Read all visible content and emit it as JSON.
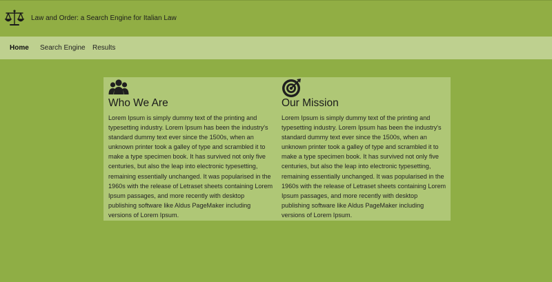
{
  "header": {
    "app_title": "Law and Order: a Search Engine for Italian Law",
    "logo_icon": "scales-of-justice-icon"
  },
  "nav": {
    "items": [
      {
        "label": "Home",
        "active": true
      },
      {
        "label": "Search Engine",
        "active": false
      },
      {
        "label": "Results",
        "active": false
      }
    ]
  },
  "sections": [
    {
      "icon": "users-icon",
      "title": "Who We Are",
      "body": "Lorem Ipsum is simply dummy text of the printing and typesetting industry. Lorem Ipsum has been the industry's standard dummy text ever since the 1500s, when an unknown printer took a galley of type and scrambled it to make a type specimen book. It has survived not only five centuries, but also the leap into electronic typesetting, remaining essentially unchanged. It was popularised in the 1960s with the release of Letraset sheets containing Lorem Ipsum passages, and more recently with desktop publishing software like Aldus PageMaker including versions of Lorem Ipsum."
    },
    {
      "icon": "target-icon",
      "title": "Our Mission",
      "body": "Lorem Ipsum is simply dummy text of the printing and typesetting industry. Lorem Ipsum has been the industry's standard dummy text ever since the 1500s, when an unknown printer took a galley of type and scrambled it to make a type specimen book. It has survived not only five centuries, but also the leap into electronic typesetting, remaining essentially unchanged. It was popularised in the 1960s with the release of Letraset sheets containing Lorem Ipsum passages, and more recently with desktop publishing software like Aldus PageMaker including versions of Lorem Ipsum."
    }
  ],
  "colors": {
    "page_background": "#8fae45",
    "nav_background": "#bed08f",
    "card_background": "#afc776"
  }
}
